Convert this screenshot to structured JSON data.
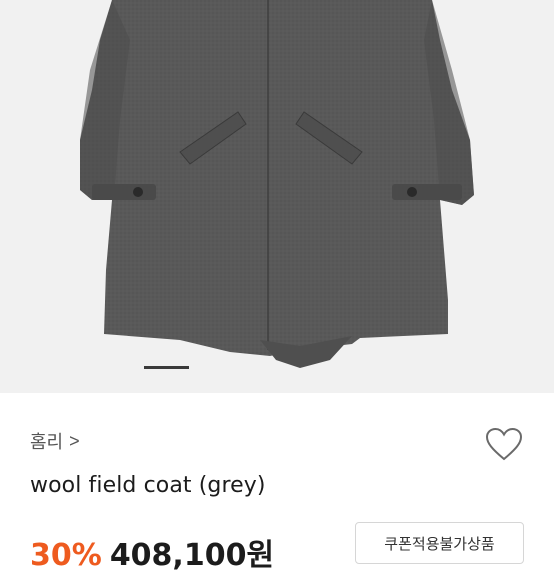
{
  "product": {
    "brand": "홈리",
    "brand_chevron": ">",
    "title": "wool field coat (grey)",
    "discount": "30%",
    "price": "408,100원",
    "coupon_label": "쿠폰적용불가상품"
  },
  "gallery": {
    "image_alt": "grey wool field coat",
    "indicator_active": 1
  },
  "colors": {
    "discount": "#ee5b1f",
    "image_bg": "#f1f1f1",
    "coat": "#5a5a5a"
  },
  "icons": {
    "like": "heart-outline-icon",
    "chevron": "chevron-right-icon"
  }
}
